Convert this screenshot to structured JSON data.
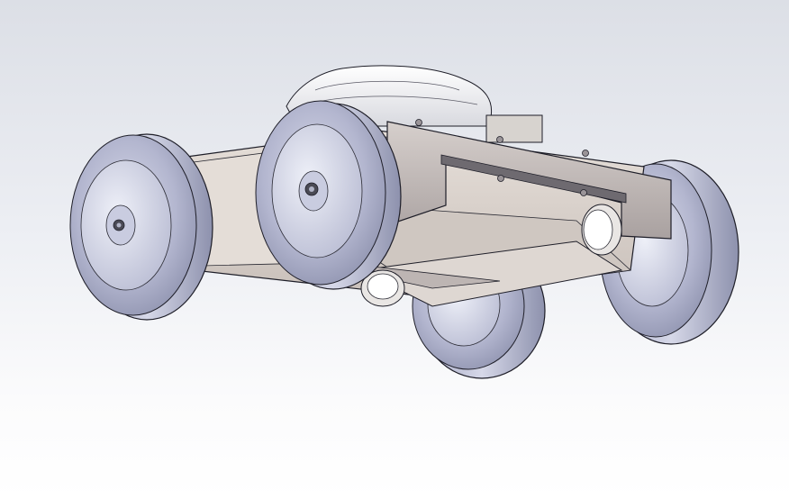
{
  "viewport": {
    "background_top": "#dcdfe6",
    "background_bottom": "#ffffff",
    "view_mode": "shaded-with-edges"
  },
  "model": {
    "type": "four-wheel-robot-chassis",
    "parts": [
      "frame",
      "wheel-front-left",
      "wheel-front-right",
      "wheel-rear-left",
      "wheel-rear-right",
      "motor-cover",
      "side-rail",
      "skid-plate",
      "motor-mounts"
    ],
    "colors": {
      "tire": "#a8acc8",
      "rim": "#c6c9dd",
      "frame": "#d8d0ca",
      "rail": "#bdb5b3",
      "outline": "#1e1e28"
    }
  }
}
